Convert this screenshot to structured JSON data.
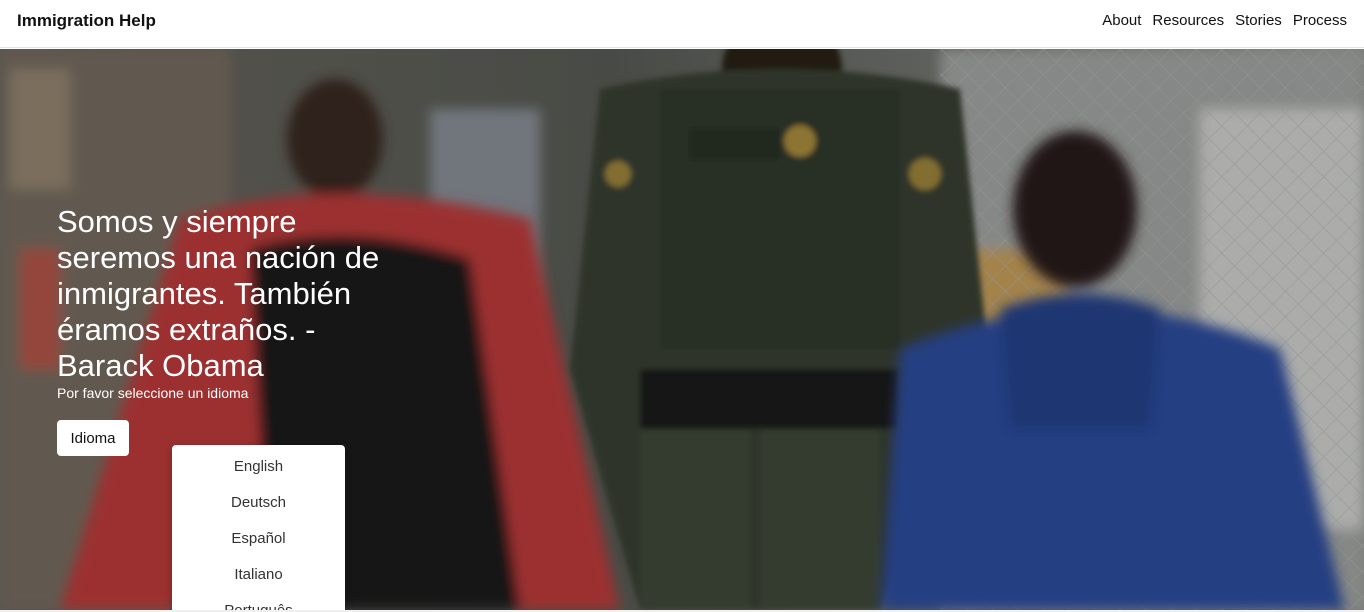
{
  "navbar": {
    "brand": "Immigration Help",
    "links": [
      "About",
      "Resources",
      "Stories",
      "Process"
    ]
  },
  "hero": {
    "quote": "Somos y siempre seremos una nación de inmigrantes. También éramos extraños. - Barack Obama",
    "subtitle": "Por favor seleccione un idioma",
    "language_button": "Idioma",
    "language_options": [
      "English",
      "Deutsch",
      "Español",
      "Italiano",
      "Português"
    ]
  },
  "colors": {
    "nav_background": "#ffffff",
    "hero_text": "#ffffff",
    "dropdown_background": "#ffffff"
  }
}
